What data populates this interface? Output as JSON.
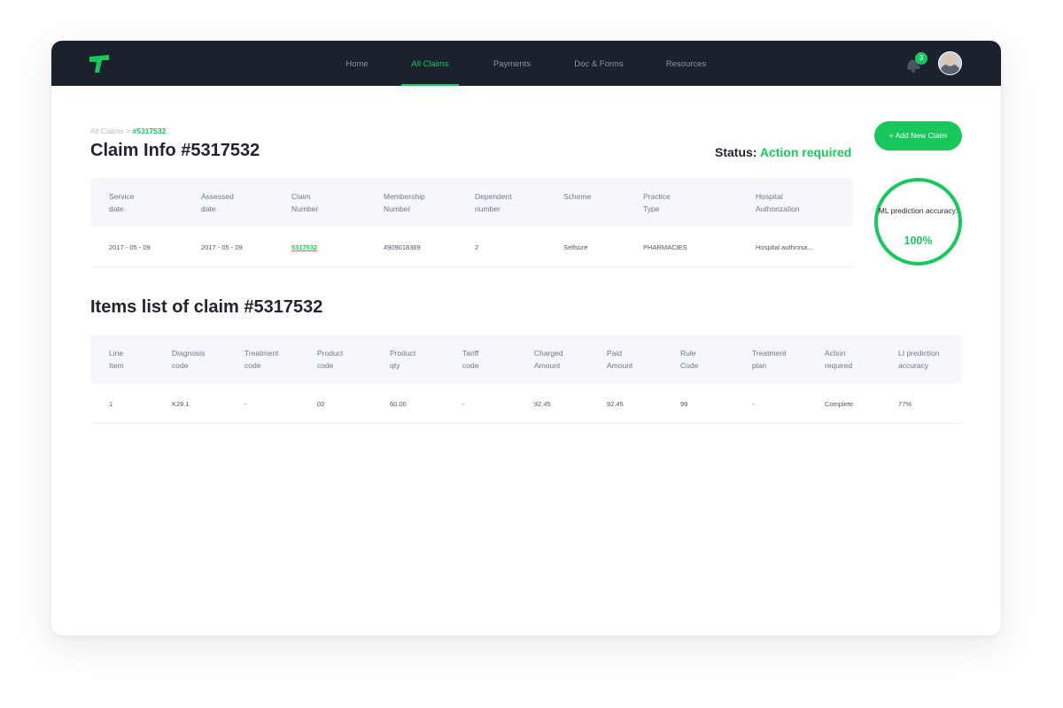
{
  "nav": {
    "items": [
      {
        "label": "Home",
        "active": false
      },
      {
        "label": "All Claims",
        "active": true
      },
      {
        "label": "Payments",
        "active": false
      },
      {
        "label": "Doc & Forms",
        "active": false
      },
      {
        "label": "Resources",
        "active": false
      }
    ],
    "notification_count": "3",
    "accent": "#19c85d",
    "bar_color": "#1b222d"
  },
  "breadcrumb": {
    "parent": "All Claims",
    "separator": ">",
    "current": "#5317532"
  },
  "claim": {
    "title": "Claim Info #5317532",
    "status_label": "Status:",
    "status_value": "Action required",
    "add_button": "+ Add New Claim",
    "ml_label": "ML prediction accuracy:",
    "ml_value": "100%",
    "columns": [
      "Service\ndate",
      "Assessed\ndate",
      "Claim\nNumber",
      "Membership\nNumber",
      "Dependent\nnumber",
      "Scheme",
      "Practice\nType",
      "Hospital\nAuthorization"
    ],
    "rows": [
      [
        "2017 - 05 - 09",
        "2017 - 05 - 09",
        "5317532",
        "4909018369",
        "2",
        "Selfsure",
        "PHARMACIES",
        "Hospital authrosa..."
      ]
    ]
  },
  "items": {
    "title": "Items list of claim #5317532",
    "columns": [
      "Line\nItem",
      "Diagnosis\ncode",
      "Treatment\ncode",
      "Product\ncode",
      "Product\nqty",
      "Tariff\ncode",
      "Charged\nAmount",
      "Paid\nAmount",
      "Rule\nCode",
      "Treatment\nplan",
      "Action\nrequired",
      "LI prediction\naccuracy"
    ],
    "rows": [
      [
        "1",
        "K29.1",
        "-",
        "02",
        "60.00",
        "-",
        "92.45",
        "92.45",
        "99",
        "-",
        "Complete",
        "77%"
      ]
    ]
  },
  "icons": [
    "logo-icon",
    "bell-icon",
    "avatar"
  ]
}
